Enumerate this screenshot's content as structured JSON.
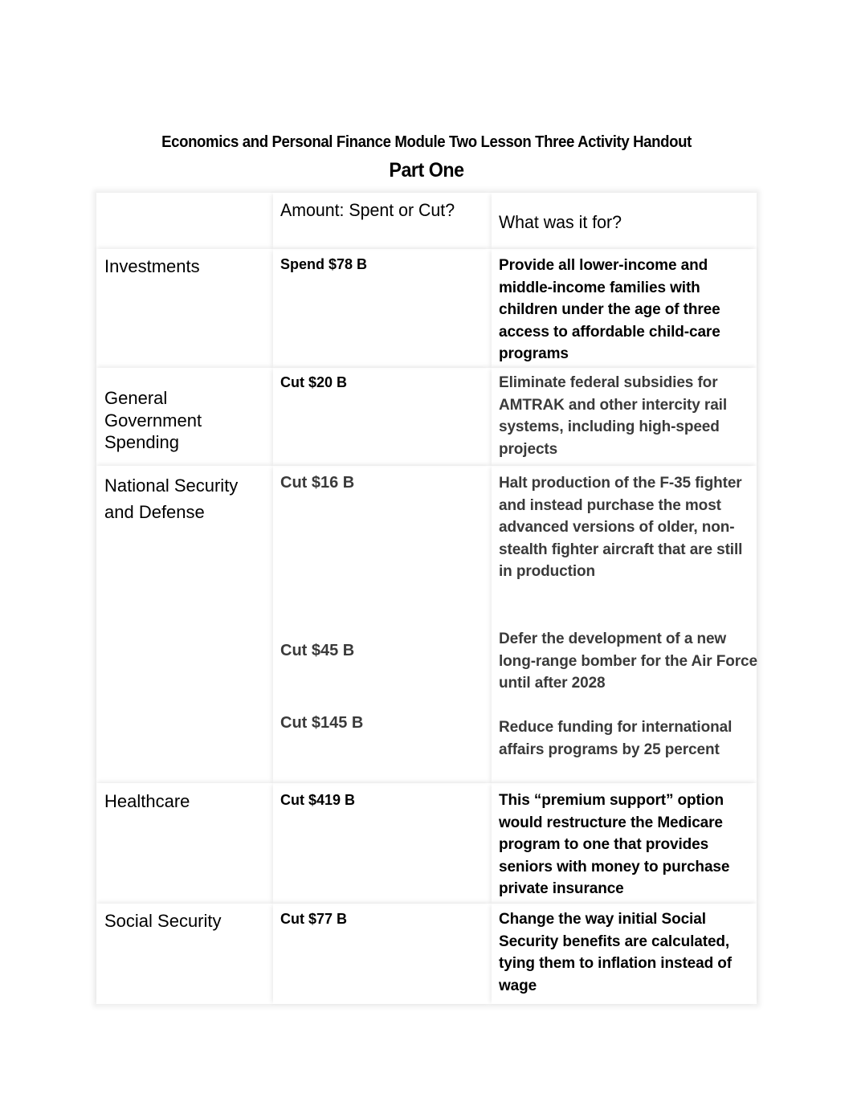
{
  "document": {
    "title": "Economics and Personal Finance Module Two Lesson Three Activity Handout",
    "part_title": "Part One"
  },
  "table": {
    "headers": [
      "",
      "Amount: Spent or Cut?",
      "What was it for?"
    ],
    "rows": [
      {
        "category": "Investments",
        "entries": [
          {
            "amount": "Spend $78 B",
            "description": "Provide all lower-income and middle-income families with children under the age of three access to affordable child-care programs"
          }
        ]
      },
      {
        "category": "General Government Spending",
        "entries": [
          {
            "amount": "Cut $20 B",
            "description": "Eliminate federal subsidies for AMTRAK and other intercity rail systems, including high-speed projects"
          }
        ]
      },
      {
        "category": "National Security and Defense",
        "entries": [
          {
            "amount": "Cut $16 B",
            "description": "Halt production of the F-35 fighter and instead purchase the most advanced versions of older, non-stealth fighter aircraft that are still in production"
          },
          {
            "amount": "Cut $45 B",
            "description": "Defer the development of a new long-range bomber for the Air Force until after 2028"
          },
          {
            "amount": "Cut $145 B",
            "description": "Reduce funding for international affairs programs by 25 percent"
          }
        ]
      },
      {
        "category": "Healthcare",
        "entries": [
          {
            "amount": "Cut $419 B",
            "description": "This “premium support” option would restructure the Medicare program to one that provides seniors with money to purchase private insurance"
          }
        ]
      },
      {
        "category": "Social Security",
        "entries": [
          {
            "amount": "Cut $77 B",
            "description": "Change the way initial Social Security benefits are calculated, tying them to inflation instead of wage"
          }
        ]
      }
    ]
  }
}
